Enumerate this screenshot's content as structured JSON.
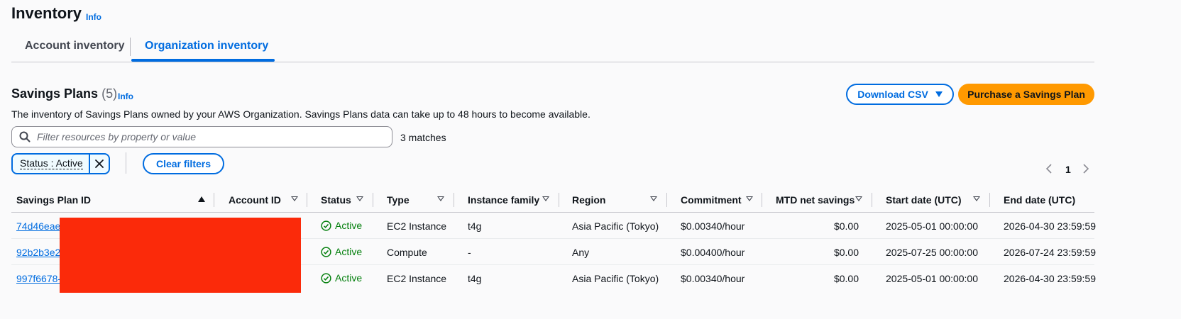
{
  "header": {
    "title": "Inventory",
    "info": "Info"
  },
  "tabs": [
    {
      "label": "Account inventory",
      "active": false
    },
    {
      "label": "Organization inventory",
      "active": true
    }
  ],
  "section": {
    "title": "Savings Plans",
    "count": "(5)",
    "info": "Info",
    "description": "The inventory of Savings Plans owned by your AWS Organization. Savings Plans data can take up to 48 hours to become available."
  },
  "actions": {
    "download_csv": "Download CSV",
    "purchase": "Purchase a Savings Plan"
  },
  "filter": {
    "placeholder": "Filter resources by property or value",
    "matches": "3 matches",
    "token": "Status : Active",
    "clear": "Clear filters"
  },
  "pagination": {
    "current": "1"
  },
  "table": {
    "columns": [
      "Savings Plan ID",
      "Account ID",
      "Status",
      "Type",
      "Instance family",
      "Region",
      "Commitment",
      "MTD net savings",
      "Start date (UTC)",
      "End date (UTC)"
    ],
    "rows": [
      {
        "id": "74d46eae-",
        "status": "Active",
        "type": "EC2 Instance",
        "family": "t4g",
        "region": "Asia Pacific (Tokyo)",
        "commitment": "$0.00340/hour",
        "savings": "$0.00",
        "start": "2025-05-01 00:00:00",
        "end": "2026-04-30 23:59:59"
      },
      {
        "id": "92b2b3e2",
        "status": "Active",
        "type": "Compute",
        "family": "-",
        "region": "Any",
        "commitment": "$0.00400/hour",
        "savings": "$0.00",
        "start": "2025-07-25 00:00:00",
        "end": "2026-07-24 23:59:59"
      },
      {
        "id": "997f6678-",
        "status": "Active",
        "type": "EC2 Instance",
        "family": "t4g",
        "region": "Asia Pacific (Tokyo)",
        "commitment": "$0.00340/hour",
        "savings": "$0.00",
        "start": "2025-05-01 00:00:00",
        "end": "2026-04-30 23:59:59"
      }
    ]
  },
  "colors": {
    "link": "#006ce0",
    "primary": "#ff9900",
    "success": "#037f0c",
    "redaction": "#fb2a0a"
  }
}
